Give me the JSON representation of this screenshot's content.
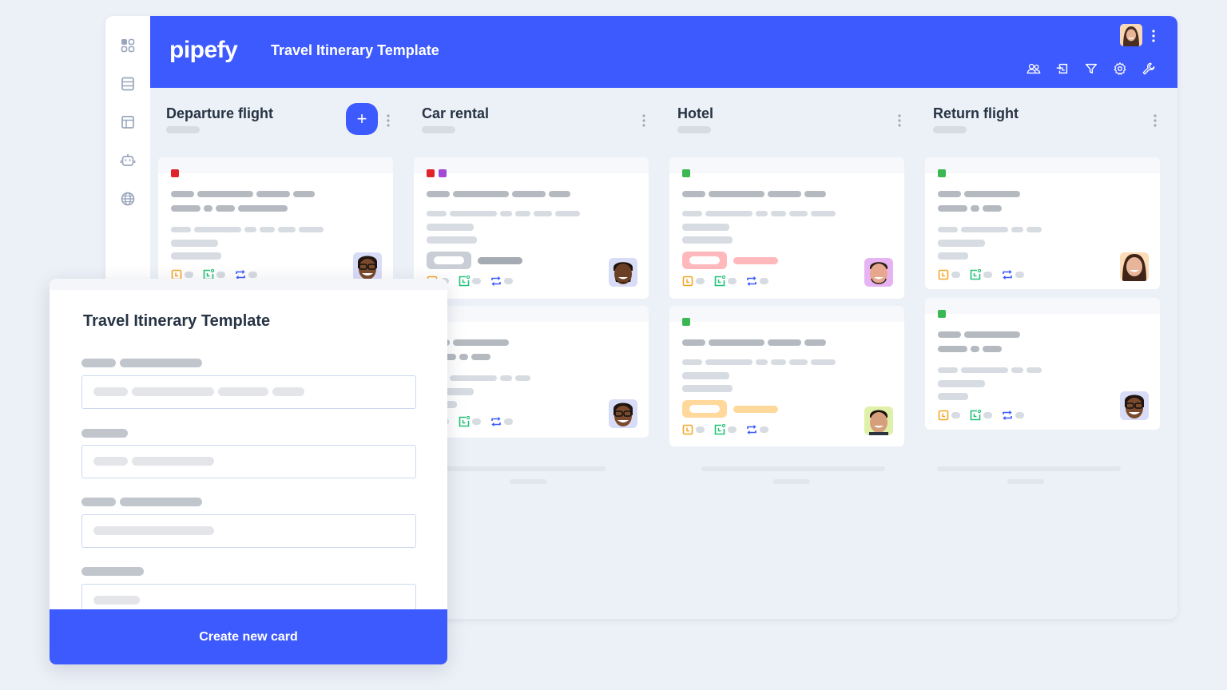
{
  "app": {
    "logo": "pipefy",
    "title": "Travel Itinerary Template"
  },
  "sidebar": {
    "items": [
      {
        "icon": "apps-grid-icon"
      },
      {
        "icon": "database-icon"
      },
      {
        "icon": "layout-panel-icon"
      },
      {
        "icon": "robot-automation-icon"
      },
      {
        "icon": "globe-icon"
      }
    ]
  },
  "header": {
    "tools": [
      "members-icon",
      "import-icon",
      "filter-icon",
      "settings-icon",
      "wrench-icon"
    ]
  },
  "phases": [
    {
      "title": "Departure flight",
      "has_add_button": true,
      "add_label": "+"
    },
    {
      "title": "Car rental"
    },
    {
      "title": "Hotel"
    },
    {
      "title": "Return flight"
    }
  ],
  "colors": {
    "brand": "#3d5afe",
    "label_red": "#e0242a",
    "label_purple": "#a14ad8",
    "label_green": "#3cb852",
    "due_orange": "#f5a623",
    "start_green": "#22c17a",
    "repeat_blue": "#3d5afe",
    "chip_gray": "#c9ced6",
    "chip_red": "#ffb9bd",
    "chip_orange": "#ffd89c"
  },
  "modal": {
    "title": "Travel Itinerary Template",
    "create_button": "Create new card"
  }
}
